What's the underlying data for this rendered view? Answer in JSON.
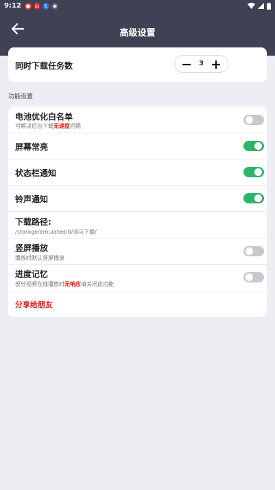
{
  "status_bar": {
    "time": "9:12",
    "icon_badges": [
      "●",
      "山",
      "$",
      "◉"
    ],
    "icons": [
      "wifi-icon",
      "signal-icon",
      "battery-icon"
    ]
  },
  "app_bar": {
    "title": "高级设置",
    "back_icon": "arrow-left-icon"
  },
  "download_tasks": {
    "label": "同时下载任务数",
    "value": "3"
  },
  "section": {
    "label": "功能设置"
  },
  "settings": {
    "battery_whitelist": {
      "label": "电池优化白名单",
      "sub_before": "可解决后台下载",
      "sub_highlight": "无速度",
      "sub_after": "问题",
      "enabled": false
    },
    "screen_on": {
      "label": "屏幕常亮",
      "enabled": true
    },
    "status_notify": {
      "label": "状态栏通知",
      "enabled": true
    },
    "ring_notify": {
      "label": "铃声通知",
      "enabled": true
    },
    "download_path": {
      "label": "下载路径:",
      "value": "/storage/emulated/0/海马下载/"
    },
    "portrait_play": {
      "label": "竖屏播放",
      "sub": "播放时默认竖屏播放",
      "enabled": false
    },
    "progress_memory": {
      "label": "进度记忆",
      "sub_before": "部分视频在线播放时",
      "sub_highlight": "无响应",
      "sub_after": "请关闭此功能",
      "enabled": false
    },
    "share": {
      "label": "分享给朋友"
    }
  },
  "colors": {
    "app_bar": "#3f4254",
    "toggle_on": "#2fb36a",
    "toggle_off": "#c9c9cd",
    "highlight": "#e21b1b"
  }
}
